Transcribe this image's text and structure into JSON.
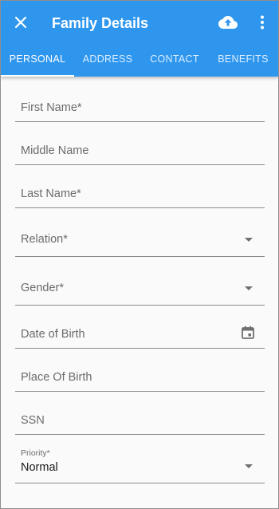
{
  "appbar": {
    "title": "Family Details",
    "close_icon": "close-icon",
    "upload_icon": "cloud-upload-icon",
    "more_icon": "more-vert-icon",
    "color": "#2f96ee"
  },
  "tabs": [
    {
      "label": "PERSONAL",
      "active": true
    },
    {
      "label": "ADDRESS",
      "active": false
    },
    {
      "label": "CONTACT",
      "active": false
    },
    {
      "label": "BENEFITS",
      "active": false
    }
  ],
  "form": {
    "first_name": {
      "placeholder": "First Name*",
      "value": ""
    },
    "middle_name": {
      "placeholder": "Middle Name",
      "value": ""
    },
    "last_name": {
      "placeholder": "Last Name*",
      "value": ""
    },
    "relation": {
      "placeholder": "Relation*",
      "value": ""
    },
    "gender": {
      "placeholder": "Gender*",
      "value": ""
    },
    "date_of_birth": {
      "placeholder": "Date of Birth",
      "value": "",
      "icon": "calendar-icon"
    },
    "place_of_birth": {
      "placeholder": "Place Of Birth",
      "value": ""
    },
    "ssn": {
      "placeholder": "SSN",
      "value": ""
    },
    "priority": {
      "label": "Priority*",
      "value": "Normal"
    }
  }
}
